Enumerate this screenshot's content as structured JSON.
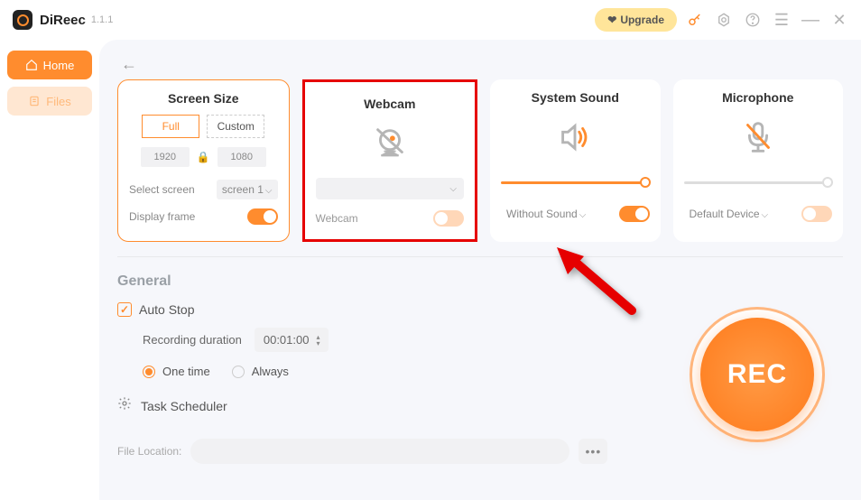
{
  "app": {
    "name": "DiReec",
    "version": "1.1.1"
  },
  "titlebar": {
    "upgrade_label": "Upgrade"
  },
  "sidebar": {
    "items": [
      {
        "label": "Home",
        "active": true
      },
      {
        "label": "Files",
        "active": false
      }
    ]
  },
  "panels": {
    "screen": {
      "title": "Screen Size",
      "mode_full": "Full",
      "mode_custom": "Custom",
      "width": "1920",
      "height": "1080",
      "select_label": "Select screen",
      "select_value": "screen 1",
      "display_frame_label": "Display frame",
      "display_frame_on": true
    },
    "webcam": {
      "title": "Webcam",
      "dropdown_value": "",
      "label": "Webcam",
      "on": false
    },
    "sound": {
      "title": "System Sound",
      "dropdown_value": "Without Sound",
      "on": true
    },
    "mic": {
      "title": "Microphone",
      "dropdown_value": "Default Device",
      "on": false
    }
  },
  "general": {
    "title": "General",
    "autostop_label": "Auto Stop",
    "duration_label": "Recording duration",
    "duration_value": "00:01:00",
    "onetime_label": "One time",
    "always_label": "Always",
    "scheduler_label": "Task Scheduler",
    "file_location_label": "File Location:",
    "file_location_value": ""
  },
  "rec": {
    "label": "REC"
  },
  "colors": {
    "accent": "#ff8c2e"
  }
}
